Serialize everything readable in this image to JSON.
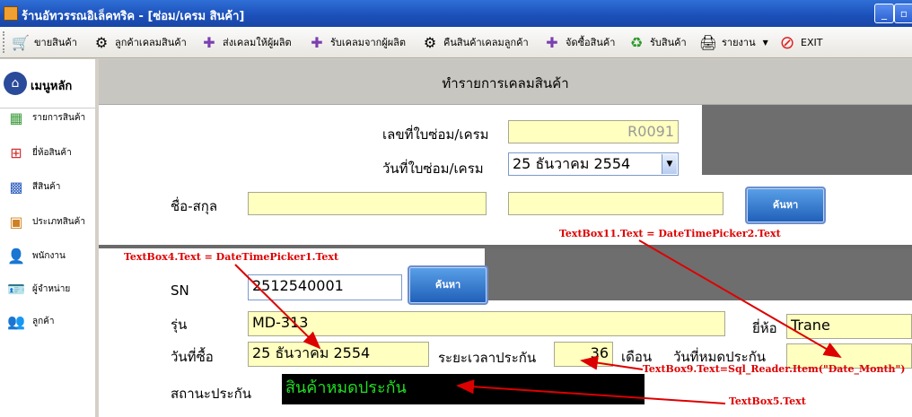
{
  "window": {
    "title": "ร้านอัทวรรณอิเล็คทริค - [ซ่อม/เครม สินค้า]"
  },
  "toolbar": {
    "items": [
      {
        "label": "ขายสินค้า",
        "icon": "cart-icon"
      },
      {
        "label": "ลูกค้าเคลมสินค้า",
        "icon": "gear-warning-icon"
      },
      {
        "label": "ส่งเคลมให้ผู้ผลิต",
        "icon": "puzzle-icon"
      },
      {
        "label": "รับเคลมจากผู้ผลิต",
        "icon": "puzzle-icon"
      },
      {
        "label": "คืนสินค้าเคลมลูกค้า",
        "icon": "gear-icon"
      },
      {
        "label": "จัดซื้อสินค้า",
        "icon": "puzzle-icon"
      },
      {
        "label": "รับสินค้า",
        "icon": "recycle-icon"
      },
      {
        "label": "รายงาน",
        "icon": "printer-icon"
      },
      {
        "label": "EXIT",
        "icon": "exit-icon"
      }
    ]
  },
  "sidebar": {
    "title": "เมนูหลัก",
    "items": [
      {
        "label": "รายการสินค้า"
      },
      {
        "label": "ยี่ห้อสินค้า"
      },
      {
        "label": "สีสินค้า"
      },
      {
        "label": "ประเภทสินค้า"
      },
      {
        "label": "พนักงาน"
      },
      {
        "label": "ผู้จำหน่าย"
      },
      {
        "label": "ลูกค้า"
      }
    ]
  },
  "form": {
    "header": "ทำรายการเคลมสินค้า",
    "repair_no_label": "เลขที่ใบซ่อม/เครม",
    "repair_no_value": "R0091",
    "repair_date_label": "วันที่ใบซ่อม/เครม",
    "repair_date_value": "25   ธันวาคม    2554",
    "name_label": "ชื่อ-สกุล",
    "name_value_1": "",
    "name_value_2": "",
    "search_button": "ค้นหา",
    "sn_label": "SN",
    "sn_value": "2512540001",
    "sn_search_button": "ค้นหา",
    "model_label": "รุ่น",
    "model_value": "MD-313",
    "brand_label": "ยี่ห้อ",
    "brand_value": "Trane",
    "purchase_date_label": "วันที่ซื้อ",
    "purchase_date_value": "25 ธันวาคม 2554",
    "warranty_period_label": "ระยะเวลาประกัน",
    "warranty_period_value": "36",
    "month_label": "เดือน",
    "expire_label": "วันที่หมดประกัน",
    "expire_value": "",
    "status_label": "สถานะประกัน",
    "status_value": "สินค้าหมดประกัน"
  },
  "annotations": {
    "a1": "TextBox11.Text = DateTimePicker2.Text",
    "a2": "TextBox4.Text = DateTimePicker1.Text",
    "a3": "TextBox9.Text=Sql_Reader.Item(\"Date_Month\")",
    "a4": "TextBox5.Text"
  },
  "colors": {
    "field_bg": "#ffffc0",
    "status_text": "#22dd22",
    "annotation": "#dd0000"
  }
}
